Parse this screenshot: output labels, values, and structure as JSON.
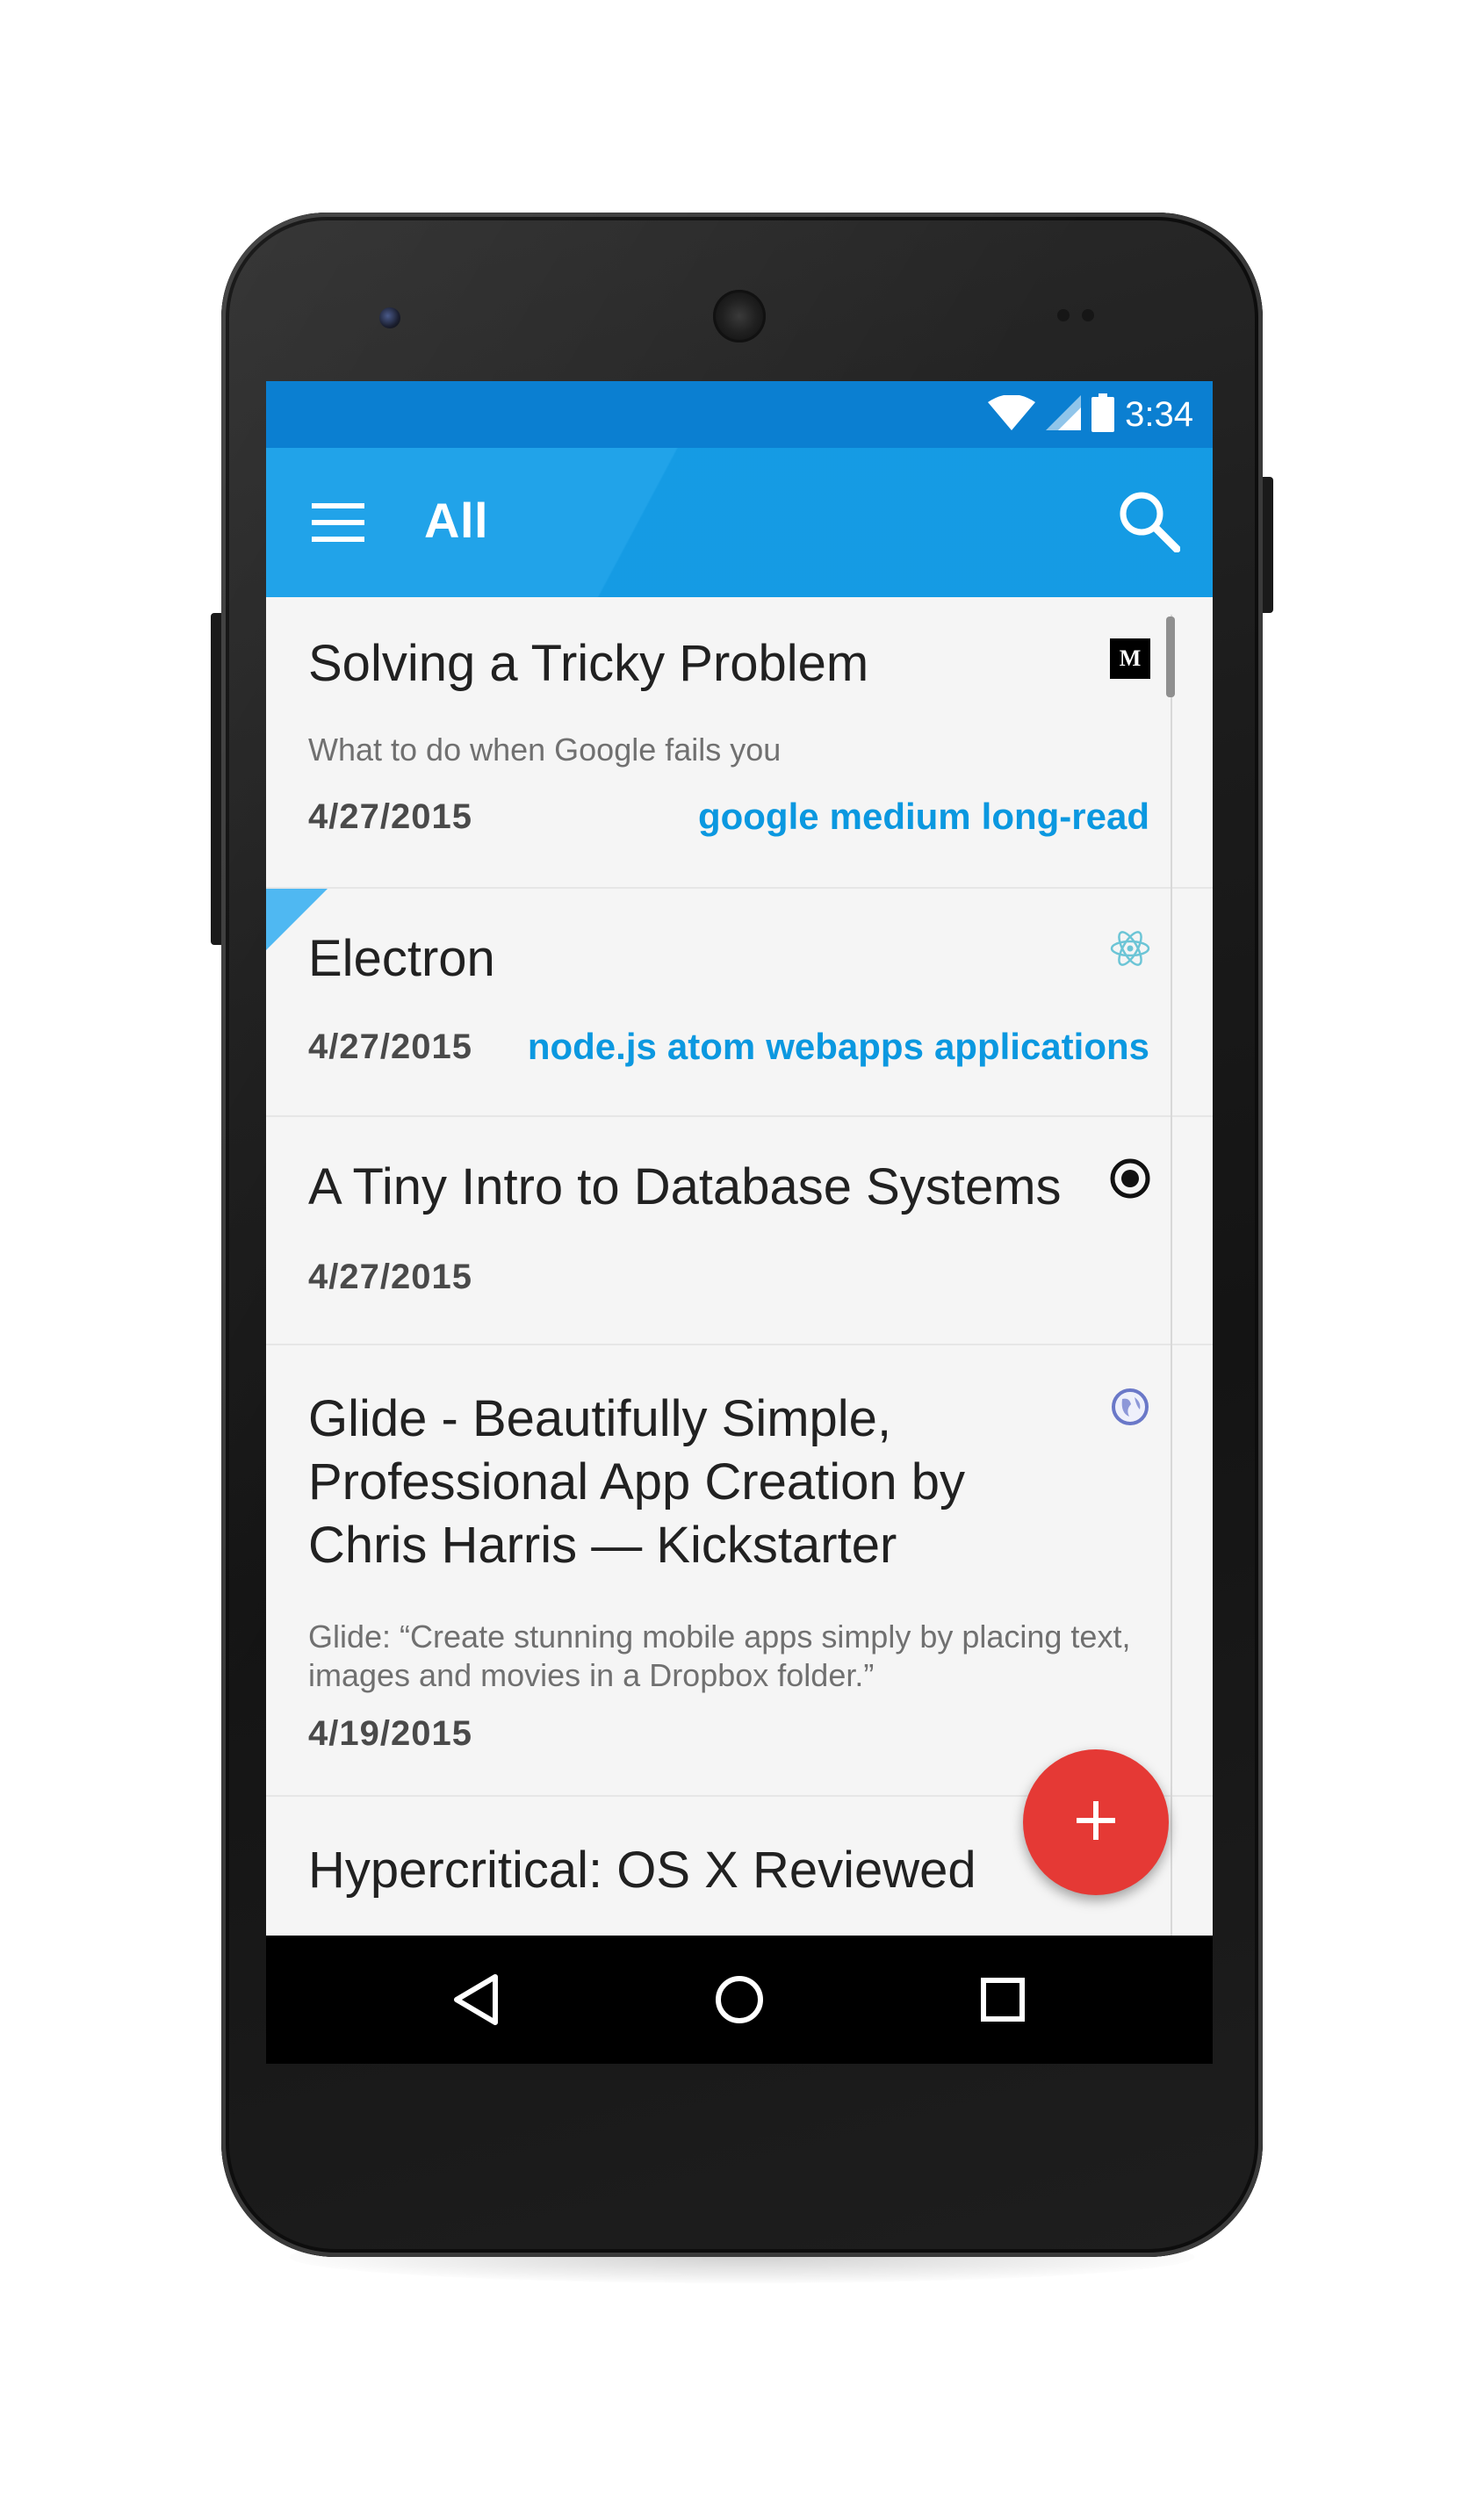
{
  "status_bar": {
    "time": "3:34",
    "icons": [
      "wifi-icon",
      "cell-signal-icon",
      "battery-icon"
    ]
  },
  "toolbar": {
    "title": "All",
    "menu_icon": "hamburger-menu-icon",
    "search_icon": "search-icon"
  },
  "articles": [
    {
      "title": "Solving a Tricky Problem",
      "description": "What to do when Google fails you",
      "date": "4/27/2015",
      "tags": [
        "google",
        "medium",
        "long-read"
      ],
      "source_icon": "medium-logo-icon",
      "source_glyph": "M"
    },
    {
      "title": "Electron",
      "date": "4/27/2015",
      "tags": [
        "node.js",
        "atom",
        "webapps",
        "applications"
      ],
      "source_icon": "electron-logo-icon",
      "flagged": true
    },
    {
      "title": "A Tiny Intro to Database Systems",
      "date": "4/27/2015",
      "tags": [],
      "source_icon": "target-circle-icon"
    },
    {
      "title_lines": [
        "Glide - Beautifully Simple,",
        "Professional App Creation by",
        "Chris Harris — Kickstarter"
      ],
      "description_lines": [
        "Glide: “Create stunning mobile apps simply by placing text,",
        "images and movies in a Dropbox folder.”"
      ],
      "date": "4/19/2015",
      "tags": [],
      "source_icon": "globe-icon"
    },
    {
      "title": "Hypercritical: OS X Reviewed"
    }
  ],
  "fab": {
    "icon": "add-icon",
    "glyph": "+"
  },
  "nav_bar": {
    "back_icon": "back-triangle-icon",
    "home_icon": "home-circle-icon",
    "recents_icon": "recents-square-icon"
  },
  "colors": {
    "status_bar": "#0b7fd1",
    "toolbar": "#159ee8",
    "tag": "#0b98e0",
    "fab": "#e53935",
    "flag": "#4fb8f2"
  }
}
